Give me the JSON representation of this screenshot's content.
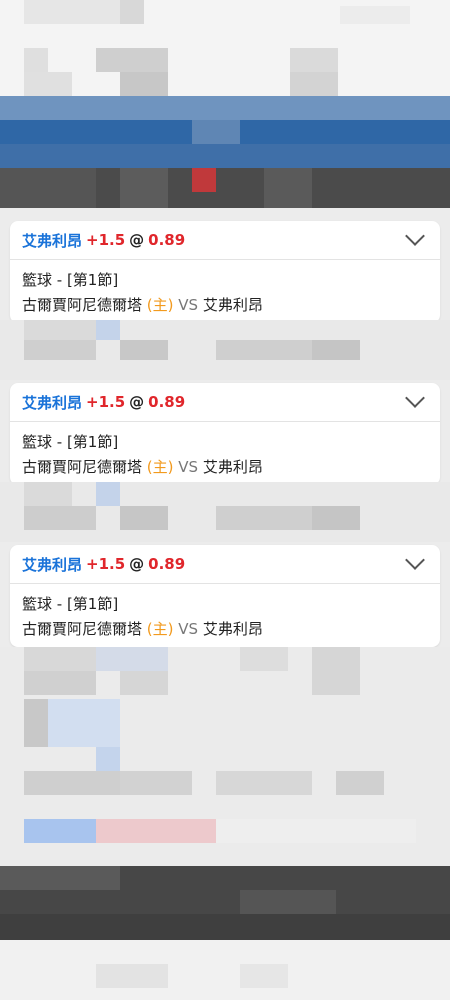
{
  "cards": [
    {
      "team": "艾弗利昂",
      "handicap": "+1.5",
      "at": "@",
      "odds": "0.89",
      "sport_period": "籃球 - [第1節]",
      "home_team": "古爾賈阿尼德爾塔",
      "home_marker": "(主)",
      "vs": "VS",
      "away_team": "艾弗利昂"
    },
    {
      "team": "艾弗利昂",
      "handicap": "+1.5",
      "at": "@",
      "odds": "0.89",
      "sport_period": "籃球 - [第1節]",
      "home_team": "古爾賈阿尼德爾塔",
      "home_marker": "(主)",
      "vs": "VS",
      "away_team": "艾弗利昂"
    },
    {
      "team": "艾弗利昂",
      "handicap": "+1.5",
      "at": "@",
      "odds": "0.89",
      "sport_period": "籃球 - [第1節]",
      "home_team": "古爾賈阿尼德爾塔",
      "home_marker": "(主)",
      "vs": "VS",
      "away_team": "艾弗利昂"
    }
  ],
  "colors": {
    "team": "#1a73d9",
    "odds": "#e0262b",
    "home_marker": "#f29a1e",
    "header_blue": "#2f67a6",
    "dark_bar": "#474747"
  },
  "icons": {
    "expand": "chevron-down-icon"
  }
}
